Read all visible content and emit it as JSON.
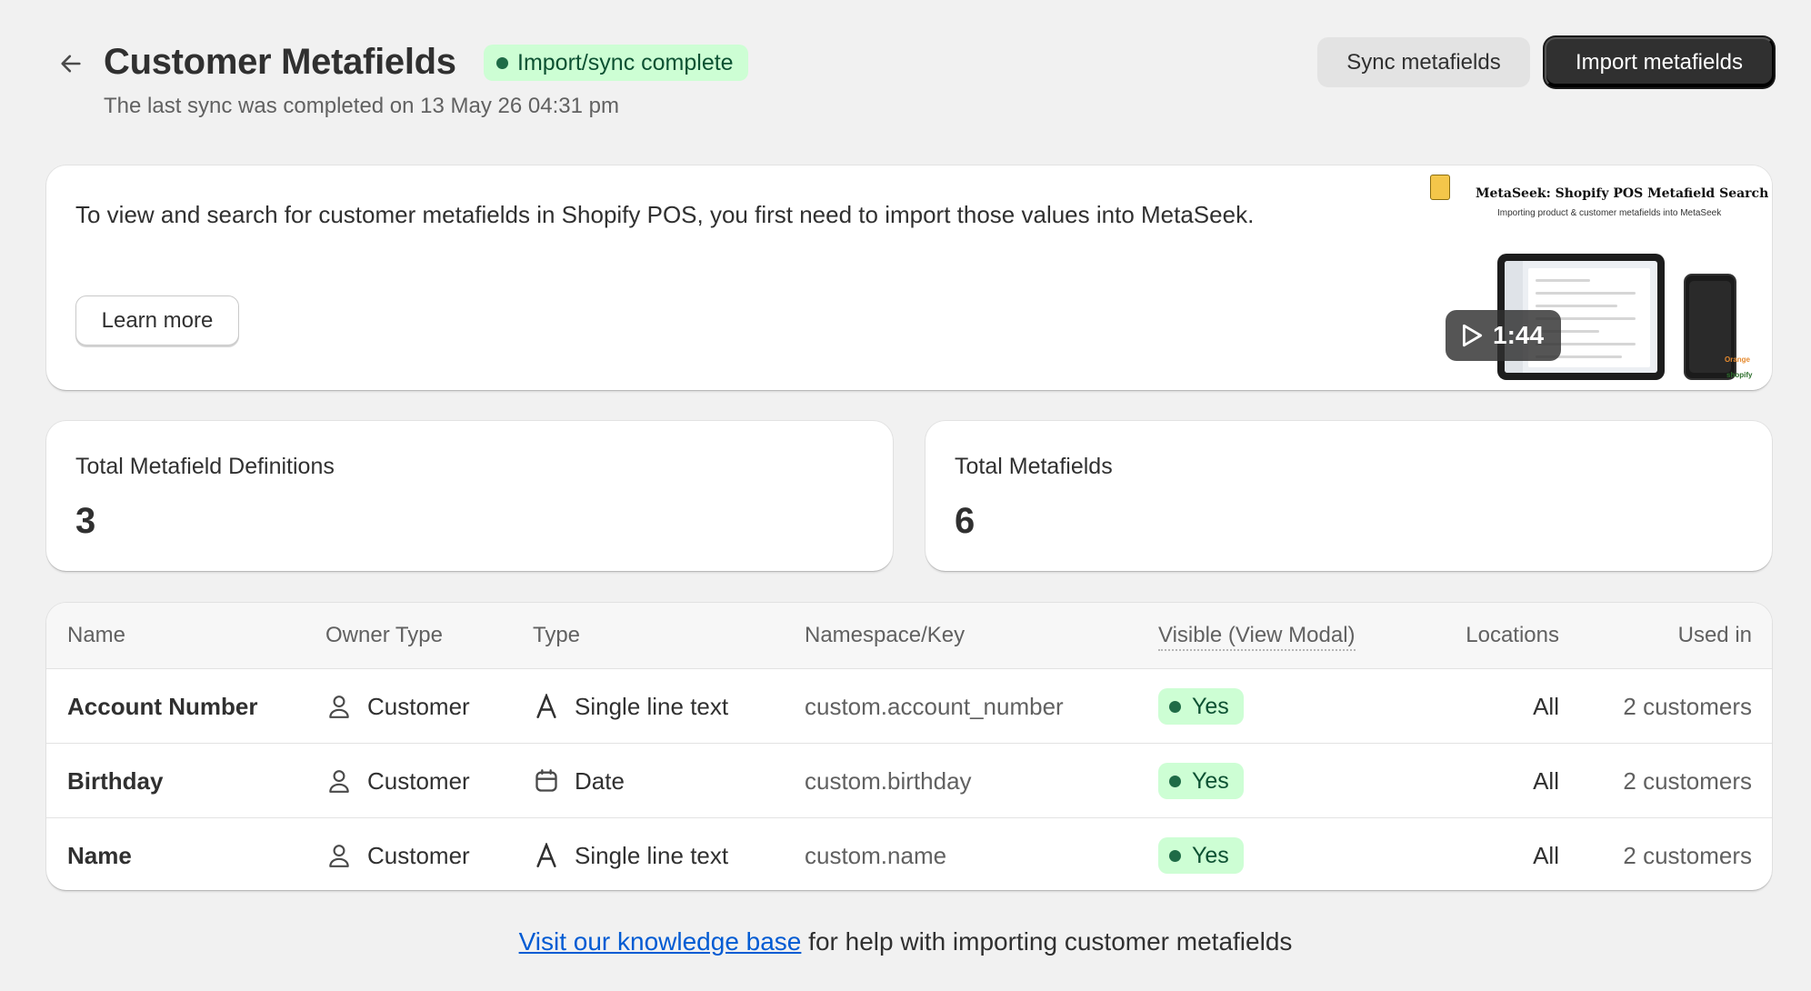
{
  "header": {
    "title": "Customer Metafields",
    "status_badge": "Import/sync complete",
    "subtitle": "The last sync was completed on 13 May 26 04:31 pm",
    "sync_button": "Sync metafields",
    "import_button": "Import metafields"
  },
  "promo": {
    "text": "To view and search for customer metafields in Shopify POS, you first need to import those values into MetaSeek.",
    "learn_more": "Learn more",
    "video": {
      "title": "MetaSeek: Shopify POS Metafield Search",
      "subtitle": "Importing product & customer metafields into MetaSeek",
      "duration": "1:44",
      "brand_top": "Orange",
      "brand_bottom": "shopify"
    }
  },
  "stats": [
    {
      "label": "Total Metafield Definitions",
      "value": "3"
    },
    {
      "label": "Total Metafields",
      "value": "6"
    }
  ],
  "table": {
    "columns": [
      "Name",
      "Owner Type",
      "Type",
      "Namespace/Key",
      "Visible (View Modal)",
      "Locations",
      "Used in"
    ],
    "rows": [
      {
        "name": "Account Number",
        "owner": "Customer",
        "type": "Single line text",
        "type_icon": "text-icon",
        "key": "custom.account_number",
        "visible": "Yes",
        "locations": "All",
        "used_in": "2 customers"
      },
      {
        "name": "Birthday",
        "owner": "Customer",
        "type": "Date",
        "type_icon": "calendar-icon",
        "key": "custom.birthday",
        "visible": "Yes",
        "locations": "All",
        "used_in": "2 customers"
      },
      {
        "name": "Name",
        "owner": "Customer",
        "type": "Single line text",
        "type_icon": "text-icon",
        "key": "custom.name",
        "visible": "Yes",
        "locations": "All",
        "used_in": "2 customers"
      }
    ]
  },
  "footer": {
    "link_text": "Visit our knowledge base",
    "rest_text": " for help with importing customer metafields"
  },
  "colors": {
    "primary_button": "#303030",
    "success_badge_bg": "#cdfed4",
    "success_badge_text": "#0c5132",
    "link": "#005bd3",
    "page_bg": "#f1f1f1"
  }
}
